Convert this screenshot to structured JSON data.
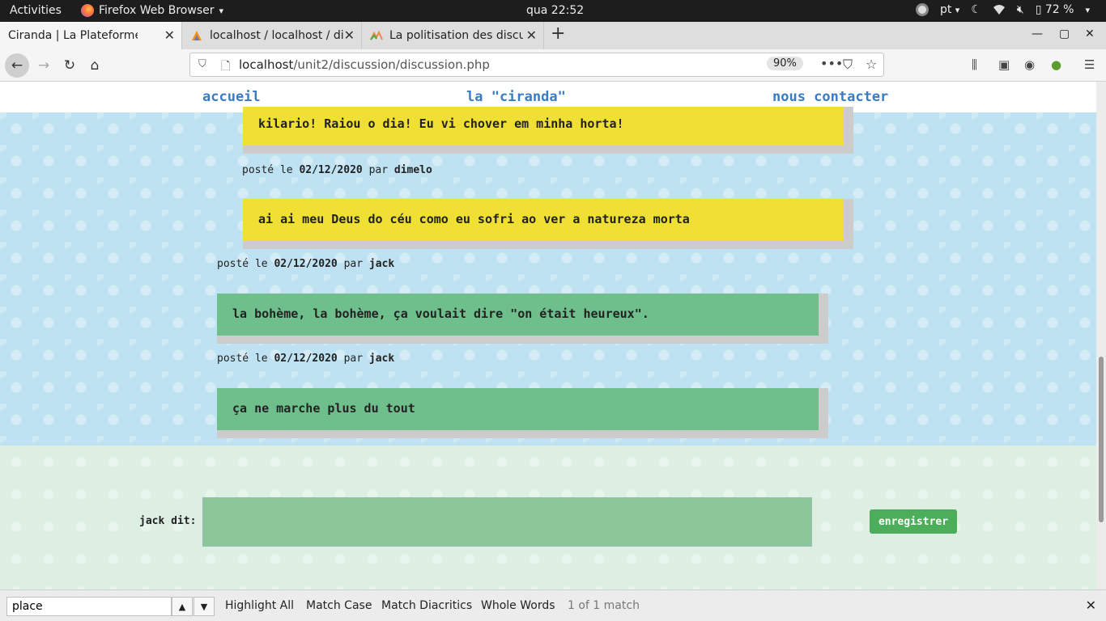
{
  "system_bar": {
    "activities": "Activities",
    "app_name": "Firefox Web Browser",
    "app_menu_arrow": "▾",
    "clock": "qua 22:52",
    "language": "pt",
    "battery": "72 %"
  },
  "browser": {
    "tabs": [
      {
        "label": "Ciranda | La Plateforme",
        "active": true
      },
      {
        "label": "localhost / localhost / dis",
        "active": false
      },
      {
        "label": "La politisation des discus",
        "active": false
      }
    ],
    "new_tab": "+",
    "url_host": "localhost",
    "url_path": "/unit2/discussion/discussion.php",
    "zoom": "90%",
    "page_actions": "•••"
  },
  "site_nav": {
    "home": "accueil",
    "about": "la \"ciranda\"",
    "contact": "nous contacter"
  },
  "messages": [
    {
      "text": "kilario! Raiou o dia! Eu vi chover em minha horta!",
      "color": "yellow"
    },
    {
      "text": "ai ai meu Deus do céu como eu sofri ao ver a natureza morta",
      "color": "yellow",
      "meta": {
        "prefix": "posté le",
        "date": "02/12/2020",
        "by": "par",
        "author": "dimelo"
      }
    },
    {
      "text": "la bohème, la bohème, ça voulait dire \"on était heureux\".",
      "color": "green",
      "meta": {
        "prefix": "posté le",
        "date": "02/12/2020",
        "by": "par",
        "author": "jack"
      }
    },
    {
      "text": "ça ne marche plus du tout",
      "color": "green",
      "meta": {
        "prefix": "posté le",
        "date": "02/12/2020",
        "by": "par",
        "author": "jack"
      }
    }
  ],
  "form": {
    "label": "jack dit:",
    "submit": "enregistrer"
  },
  "findbar": {
    "query": "place",
    "highlight_all": "Highlight All",
    "match_case": "Match Case",
    "match_diacritics": "Match Diacritics",
    "whole_words": "Whole Words",
    "status": "1 of 1 match"
  },
  "colors": {
    "nav_link": "#3a7cc4",
    "message_yellow": "#efe033",
    "message_green": "#6fbf8c",
    "button_green": "#4cae5a"
  }
}
